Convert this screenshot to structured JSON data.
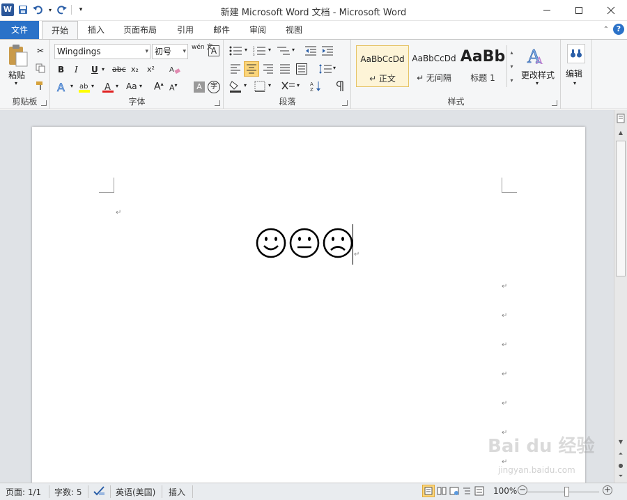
{
  "window": {
    "title": "新建 Microsoft Word 文档 - Microsoft Word",
    "logo": "W"
  },
  "tabs": [
    {
      "label": "文件"
    },
    {
      "label": "开始"
    },
    {
      "label": "插入"
    },
    {
      "label": "页面布局"
    },
    {
      "label": "引用"
    },
    {
      "label": "邮件"
    },
    {
      "label": "审阅"
    },
    {
      "label": "视图"
    }
  ],
  "ribbon": {
    "clipboard": {
      "label": "剪贴板",
      "paste": "粘贴"
    },
    "font": {
      "label": "字体",
      "font_name": "Wingdings",
      "font_size": "初号",
      "bold": "B",
      "italic": "I",
      "underline": "U",
      "strike": "abc",
      "subscript": "x₂",
      "superscript": "x²",
      "change_case": "Aa",
      "grow": "A",
      "shrink": "A",
      "wen": "wén 文",
      "border_a": "A",
      "char_shading": "A",
      "enclose": "字"
    },
    "paragraph": {
      "label": "段落"
    },
    "styles": {
      "label": "样式",
      "items": [
        {
          "sample": "AaBbCcDd",
          "name": "↵ 正文"
        },
        {
          "sample": "AaBbCcDd",
          "name": "↵ 无间隔"
        },
        {
          "sample": "AaBb",
          "name": "标题 1"
        }
      ],
      "change_styles": "更改样式"
    },
    "editing": {
      "label": "编辑"
    }
  },
  "document": {
    "faces": [
      "☺",
      "😐",
      "☹"
    ]
  },
  "statusbar": {
    "page": "页面: 1/1",
    "words": "字数: 5",
    "language": "英语(美国)",
    "mode": "插入",
    "zoom": "100%",
    "zoom_level": 1.0
  },
  "watermark": {
    "text": "Bai du 经验",
    "sub": "jingyan.baidu.com"
  },
  "colors": {
    "file_tab": "#2b72c8",
    "accent_selected": "#fdf4d7",
    "font_color_red": "#e02020",
    "highlight_yellow": "#ffff00"
  }
}
